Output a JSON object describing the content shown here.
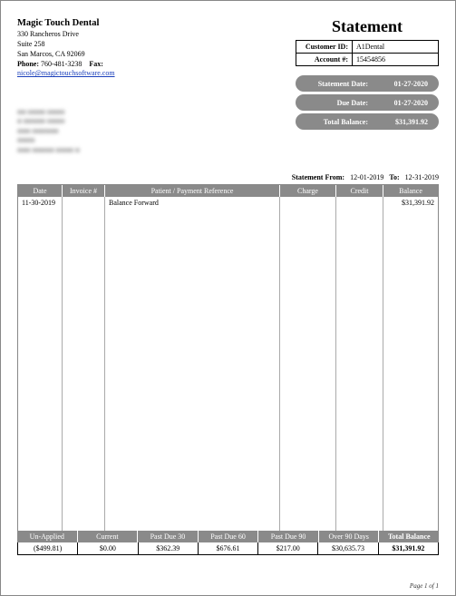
{
  "company": {
    "name": "Magic Touch Dental",
    "street": "330 Rancheros Drive",
    "suite": "Suite 258",
    "city_state_zip": "San Marcos, CA 92069",
    "phone_label": "Phone:",
    "phone": "760-481-3238",
    "fax_label": "Fax:",
    "email": "nicole@magictouchsoftware.com"
  },
  "title": "Statement",
  "id_box": {
    "customer_id_label": "Customer ID:",
    "customer_id": "A1Dental",
    "account_label": "Account #:",
    "account": "15454856"
  },
  "pills": {
    "stmt_date_label": "Statement Date:",
    "stmt_date": "01-27-2020",
    "due_date_label": "Due Date:",
    "due_date": "01-27-2020",
    "total_bal_label": "Total Balance:",
    "total_bal": "$31,391.92"
  },
  "range": {
    "from_label": "Statement From:",
    "from": "12-01-2019",
    "to_label": "To:",
    "to": "12-31-2019"
  },
  "columns": {
    "date": "Date",
    "invoice": "Invoice #",
    "reference": "Patient / Payment Reference",
    "charge": "Charge",
    "credit": "Credit",
    "balance": "Balance"
  },
  "row0": {
    "date": "11-30-2019",
    "invoice": "",
    "reference": "Balance Forward",
    "charge": "",
    "credit": "",
    "balance": "$31,391.92"
  },
  "aging": {
    "headers": {
      "unapplied": "Un-Applied",
      "current": "Current",
      "pd30": "Past Due 30",
      "pd60": "Past Due 60",
      "pd90": "Past Due 90",
      "over90": "Over 90 Days",
      "total": "Total Balance"
    },
    "values": {
      "unapplied": "($499.81)",
      "current": "$0.00",
      "pd30": "$362.39",
      "pd60": "$676.61",
      "pd90": "$217.00",
      "over90": "$30,635.73",
      "total": "$31,391.92"
    }
  },
  "page_num": "Page 1 of 1"
}
